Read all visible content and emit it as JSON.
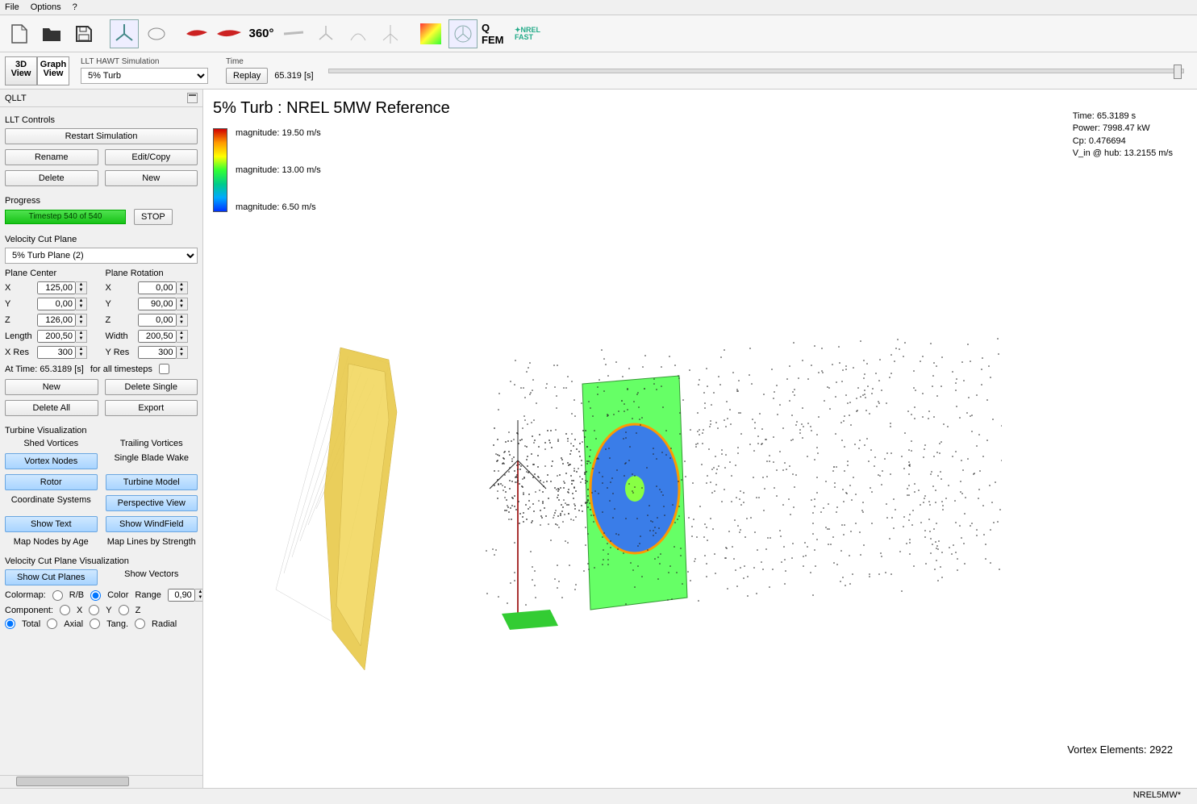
{
  "menu": {
    "file": "File",
    "options": "Options",
    "help": "?"
  },
  "toolbar": {
    "icons": [
      "new-file",
      "open-folder",
      "save",
      "blade-3d",
      "airfoil-loop",
      "airfoil-red1",
      "airfoil-red2",
      "360-deg",
      "single-blade",
      "turbine-gray",
      "polar-gray",
      "turbine-outline",
      "colormap",
      "rotor-icon",
      "qfem",
      "nrel-fast"
    ],
    "qfem": "Q FEM"
  },
  "row2": {
    "view3d": "3D\nView",
    "graphview": "Graph\nView",
    "sim_label": "LLT HAWT Simulation",
    "sim_select": "5% Turb",
    "time_label": "Time",
    "replay": "Replay",
    "time_value": "65.319 [s]"
  },
  "side": {
    "title": "QLLT",
    "llt_controls": "LLT Controls",
    "restart": "Restart Simulation",
    "rename": "Rename",
    "editcopy": "Edit/Copy",
    "delete": "Delete",
    "new": "New",
    "progress_label": "Progress",
    "progress_text": "Timestep 540 of 540",
    "stop": "STOP",
    "vcp_label": "Velocity Cut Plane",
    "vcp_select": "5% Turb Plane (2)",
    "plane_center_label": "Plane Center",
    "plane_rotation_label": "Plane Rotation",
    "center": {
      "X": "125,00",
      "Y": "0,00",
      "Z": "126,00",
      "Length": "200,50",
      "XRes": "300"
    },
    "rotation": {
      "X": "0,00",
      "Y": "90,00",
      "Z": "0,00",
      "Width": "200,50",
      "YRes": "300"
    },
    "labels": {
      "X": "X",
      "Y": "Y",
      "Z": "Z",
      "Length": "Length",
      "Width": "Width",
      "XRes": "X Res",
      "YRes": "Y Res"
    },
    "at_time": "At Time: 65.3189 [s]",
    "for_all": "for all timesteps",
    "new2": "New",
    "delete_single": "Delete Single",
    "delete_all": "Delete All",
    "export": "Export",
    "tv_label": "Turbine Visualization",
    "tv": {
      "shed": "Shed Vortices",
      "trailing": "Trailing Vortices",
      "vortex_nodes": "Vortex Nodes",
      "single_blade": "Single Blade Wake",
      "rotor": "Rotor",
      "turbine_model": "Turbine Model",
      "coord": "Coordinate Systems",
      "perspective": "Perspective View",
      "show_text": "Show Text",
      "show_windfield": "Show WindField",
      "map_nodes": "Map Nodes by Age",
      "map_lines": "Map Lines by Strength"
    },
    "vcpv_label": "Velocity Cut Plane Visualization",
    "show_cut_planes": "Show Cut Planes",
    "show_vectors": "Show Vectors",
    "colormap_label": "Colormap:",
    "rb": "R/B",
    "color": "Color",
    "range": "Range",
    "range_val": "0,90",
    "component_label": "Component:",
    "comp": {
      "x": "X",
      "y": "Y",
      "z": "Z",
      "total": "Total",
      "axial": "Axial",
      "tang": "Tang.",
      "radial": "Radial"
    }
  },
  "viewport": {
    "title": "5% Turb : NREL 5MW Reference",
    "mag_hi": "magnitude: 19.50 m/s",
    "mag_mid": "magnitude: 13.00 m/s",
    "mag_lo": "magnitude: 6.50 m/s",
    "time": "Time: 65.3189 s",
    "power": "Power: 7998.47 kW",
    "cp": "Cp: 0.476694",
    "vin": "V_in @ hub: 13.2155 m/s",
    "vortex": "Vortex Elements: 2922"
  },
  "status": "NREL5MW*"
}
